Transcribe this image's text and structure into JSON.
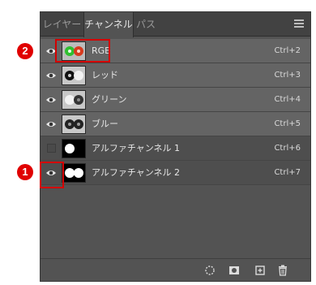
{
  "tabs": [
    {
      "label": "レイヤー",
      "active": false
    },
    {
      "label": "チャンネル",
      "active": true
    },
    {
      "label": "パス",
      "active": false
    }
  ],
  "channels": [
    {
      "name": "RGB",
      "shortcut": "Ctrl+2",
      "visible": true,
      "thumb": "rgb"
    },
    {
      "name": "レッド",
      "shortcut": "Ctrl+3",
      "visible": true,
      "thumb": "gray"
    },
    {
      "name": "グリーン",
      "shortcut": "Ctrl+4",
      "visible": true,
      "thumb": "gray"
    },
    {
      "name": "ブルー",
      "shortcut": "Ctrl+5",
      "visible": true,
      "thumb": "gray"
    },
    {
      "name": "アルファチャンネル 1",
      "shortcut": "Ctrl+6",
      "visible": false,
      "thumb": "black"
    },
    {
      "name": "アルファチャンネル 2",
      "shortcut": "Ctrl+7",
      "visible": true,
      "thumb": "black"
    }
  ],
  "annotations": [
    {
      "number": "1"
    },
    {
      "number": "2"
    }
  ],
  "colors": {
    "highlight": "#d40000",
    "panel": "#535353",
    "row_visible": "#646464"
  },
  "footer_icons": [
    "load-selection-icon",
    "save-selection-icon",
    "new-channel-icon",
    "delete-channel-icon"
  ]
}
